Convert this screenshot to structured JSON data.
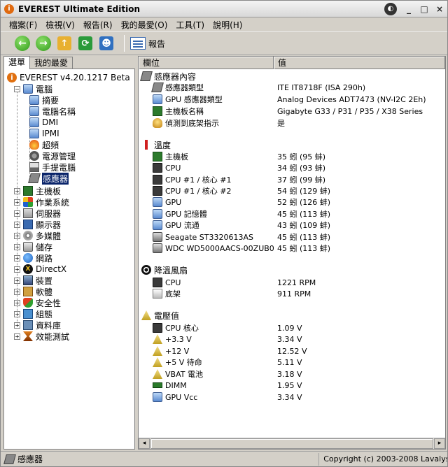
{
  "window": {
    "title": "EVEREST Ultimate Edition",
    "controls": [
      "_",
      "□",
      "×"
    ]
  },
  "menu": [
    "檔案(F)",
    "檢視(V)",
    "報告(R)",
    "我的最愛(O)",
    "工具(T)",
    "說明(H)"
  ],
  "toolbar": {
    "report_label": "報告"
  },
  "left": {
    "tabs": [
      "選單",
      "我的最愛"
    ],
    "root": "EVEREST v4.20.1217 Beta",
    "computer": "電腦",
    "computer_children": [
      "摘要",
      "電腦名稱",
      "DMI",
      "IPMI",
      "超頻",
      "電源管理",
      "手提電腦",
      "感應器"
    ],
    "categories": [
      "主機板",
      "作業系統",
      "伺服器",
      "顯示器",
      "多媒體",
      "儲存",
      "網路",
      "DirectX",
      "裝置",
      "軟體",
      "安全性",
      "組態",
      "資料庫",
      "效能測試"
    ]
  },
  "columns": {
    "field": "欄位",
    "value": "值"
  },
  "sections": {
    "sensor_props": {
      "title": "感應器內容",
      "rows": [
        {
          "field": "感應器類型",
          "value": "ITE IT8718F  (ISA 290h)"
        },
        {
          "field": "GPU 感應器類型",
          "value": "Analog Devices ADT7473  (NV-I2C 2Eh)"
        },
        {
          "field": "主機板名稱",
          "value": "Gigabyte G33 / P31 / P35 / X38 Series"
        },
        {
          "field": "偵測到底架指示",
          "value": "是"
        }
      ]
    },
    "temperature": {
      "title": "溫度",
      "rows": [
        {
          "field": "主機板",
          "value": "35 蚓 (95 蚌)"
        },
        {
          "field": "CPU",
          "value": "34 蚓 (93 蚌)"
        },
        {
          "field": "CPU #1 / 核心 #1",
          "value": "37 蚓 (99 蚌)"
        },
        {
          "field": "CPU #1 / 核心 #2",
          "value": "54 蚓 (129 蚌)"
        },
        {
          "field": "GPU",
          "value": "52 蚓 (126 蚌)"
        },
        {
          "field": "GPU 記憶體",
          "value": "45 蚓 (113 蚌)"
        },
        {
          "field": "GPU 流通",
          "value": "43 蚓 (109 蚌)"
        },
        {
          "field": "Seagate ST3320613AS",
          "value": "45 蚓 (113 蚌)"
        },
        {
          "field": "WDC WD5000AACS-00ZUB0",
          "value": "45 蚓 (113 蚌)"
        }
      ]
    },
    "fans": {
      "title": "降溫風扇",
      "rows": [
        {
          "field": "CPU",
          "value": "1221 RPM"
        },
        {
          "field": "底架",
          "value": "911 RPM"
        }
      ]
    },
    "voltage": {
      "title": "電壓值",
      "rows": [
        {
          "field": "CPU 核心",
          "value": "1.09 V"
        },
        {
          "field": "+3.3 V",
          "value": "3.34 V"
        },
        {
          "field": "+12 V",
          "value": "12.52 V"
        },
        {
          "field": "+5 V 待命",
          "value": "5.11 V"
        },
        {
          "field": "VBAT 電池",
          "value": "3.18 V"
        },
        {
          "field": "DIMM",
          "value": "1.95 V"
        },
        {
          "field": "GPU Vcc",
          "value": "3.34 V"
        }
      ]
    }
  },
  "status": {
    "left": "感應器",
    "right": "Copyright (c) 2003-2008 Lavalys"
  }
}
